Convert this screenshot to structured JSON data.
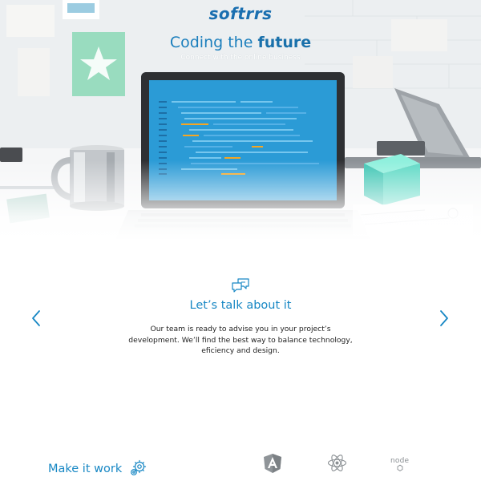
{
  "header": {
    "logo_text": "softrrs",
    "title_main": "Coding the",
    "title_bold": "future",
    "subtitle": "Connect with the online business"
  },
  "slider": {
    "title": "Let’s talk about it",
    "text": "Our team is ready to advise you in your project’s development. We’ll find the best way to balance technology, eficiency and design.",
    "icon": "chat-bubbles-icon",
    "prev_icon": "chevron-left-icon",
    "next_icon": "chevron-right-icon"
  },
  "section": {
    "title": "Make it work",
    "icon": "gear-icon"
  },
  "technologies": [
    {
      "name": "Angular",
      "icon": "angular-icon"
    },
    {
      "name": "React",
      "icon": "react-icon"
    },
    {
      "name": "node",
      "icon": "node-icon"
    }
  ],
  "colors": {
    "brand_blue": "#1787c4",
    "title_blue": "#1c7fbd",
    "screen_blue": "#2b9bd6",
    "text_dark": "#222222",
    "icon_grey": "#8a8f93"
  }
}
